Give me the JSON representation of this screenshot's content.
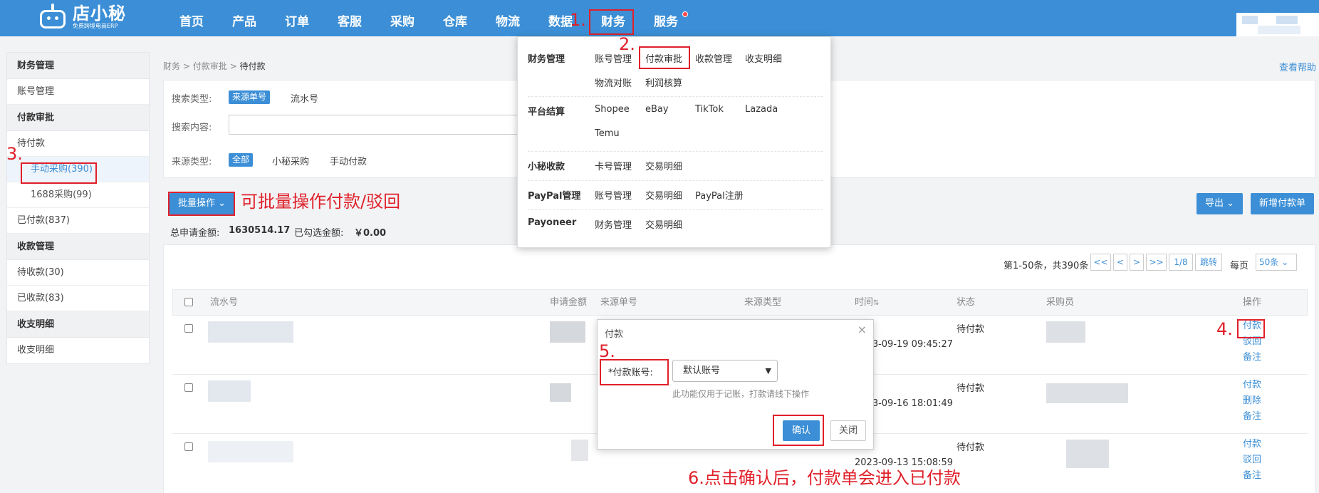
{
  "logo": {
    "name": "店小秘",
    "tagline": "免费跨境电商ERP"
  },
  "nav": {
    "items": [
      "首页",
      "产品",
      "订单",
      "客服",
      "采购",
      "仓库",
      "物流",
      "数据",
      "财务",
      "服务"
    ],
    "active": "财务"
  },
  "annotations": {
    "step1": "1.",
    "step2": "2.",
    "step3": "3.",
    "step4": "4.",
    "step5": "5.",
    "batch_note": "可批量操作付款/驳回",
    "step6": "6.点击确认后，付款单会进入已付款"
  },
  "sidebar": {
    "groups": [
      {
        "title": "财务管理",
        "items": [
          "账号管理"
        ]
      },
      {
        "title": "付款审批",
        "items": [
          "待付款",
          "手动采购(390)",
          "1688采购(99)",
          "已付款(837)"
        ]
      },
      {
        "title": "收款管理",
        "items": [
          "待收款(30)",
          "已收款(83)"
        ]
      },
      {
        "title": "收支明细",
        "items": [
          "收支明细"
        ]
      }
    ]
  },
  "breadcrumb": {
    "l1": "财务",
    "sep": ">",
    "l2": "付款审批",
    "l3": "待付款"
  },
  "help_link": "查看帮助",
  "filters": {
    "search_type_label": "搜索类型:",
    "search_type_options": [
      "来源单号",
      "流水号"
    ],
    "search_content_label": "搜索内容:",
    "source_type_label": "来源类型:",
    "source_type_options": [
      "全部",
      "小秘采购",
      "手动付款"
    ]
  },
  "toolbar": {
    "batch_label": "批量操作",
    "export_label": "导出",
    "new_label": "新增付款单"
  },
  "summary": {
    "total_label": "总申请金额:",
    "total_value": "1630514.17",
    "selected_label": "已勾选金额:",
    "selected_value": "￥0.00"
  },
  "pager": {
    "info": "第1-50条，共390条",
    "first": "<<",
    "prev": "<",
    "next": ">",
    "last": ">>",
    "page": "1/8",
    "jump": "跳转",
    "per_page_label": "每页",
    "per_page": "50条"
  },
  "table": {
    "headers": [
      "流水号",
      "申请金额",
      "来源单号",
      "来源类型",
      "时间",
      "状态",
      "采购员",
      "操作"
    ],
    "rows": [
      {
        "time": "2023-09-19 09:45:27",
        "status": "待付款",
        "actions": [
          "付款",
          "驳回",
          "备注"
        ]
      },
      {
        "time": "2023-09-16 18:01:49",
        "status": "待付款",
        "actions": [
          "付款",
          "删除",
          "备注"
        ]
      },
      {
        "time": "2023-09-13 15:08:59",
        "status": "待付款",
        "actions": [
          "付款",
          "驳回",
          "备注"
        ]
      }
    ]
  },
  "dropdown": {
    "sections": [
      {
        "title": "财务管理",
        "links": [
          "账号管理",
          "付款审批",
          "收款管理",
          "收支明细",
          "物流对账",
          "利润核算"
        ]
      },
      {
        "title": "平台结算",
        "links": [
          "Shopee",
          "eBay",
          "TikTok",
          "Lazada",
          "Temu"
        ]
      },
      {
        "title": "小秘收款",
        "links": [
          "卡号管理",
          "交易明细"
        ]
      },
      {
        "title": "PayPal管理",
        "links": [
          "账号管理",
          "交易明细",
          "PayPal注册"
        ]
      },
      {
        "title": "Payoneer",
        "links": [
          "财务管理",
          "交易明细"
        ]
      }
    ]
  },
  "modal": {
    "title": "付款",
    "close": "×",
    "account_label": "*付款账号:",
    "account_value": "默认账号",
    "note": "此功能仅用于记账，打款请线下操作",
    "confirm": "确认",
    "cancel": "关闭"
  },
  "colors": {
    "primary": "#3c8fd6",
    "annotation_red": "#e0202a"
  }
}
